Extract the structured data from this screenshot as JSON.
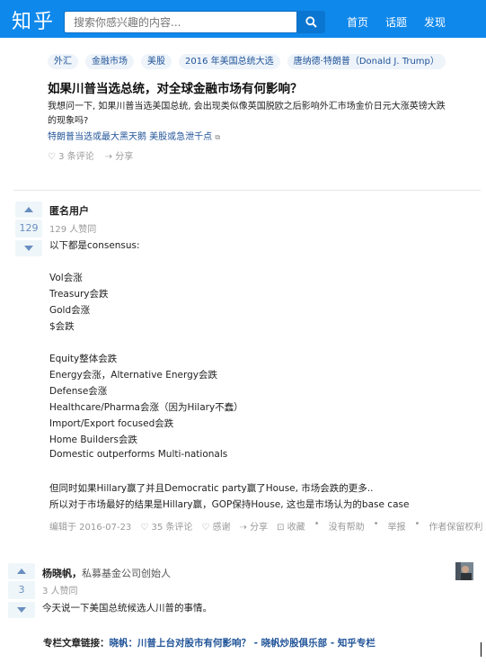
{
  "header": {
    "logo": "知乎",
    "search_placeholder": "搜索你感兴趣的内容...",
    "nav": [
      "首页",
      "话题",
      "发现"
    ],
    "color": "#0f88eb"
  },
  "question": {
    "topics": [
      "外汇",
      "金融市场",
      "美股",
      "2016 年美国总统大选",
      "唐纳德·特朗普（Donald J. Trump）"
    ],
    "title": "如果川普当选总统，对全球金融市场有何影响？",
    "desc_line1": "我想问一下, 如果川普当选美国总统, 会出现类似像英国脱欧之后影响外汇市场金价日元大涨英镑大跌",
    "desc_line2": "的现象吗?",
    "link": "特朗普当选或最大黑天鹅 美股或急泄千点",
    "comments": "3 条评论",
    "share": "分享"
  },
  "answer1": {
    "vote_count": "129",
    "author": "匿名用户",
    "votes_text": "129 人赞同",
    "lines": [
      "以下都是consensus:",
      "",
      "Vol会涨",
      "Treasury会跌",
      "Gold会涨",
      "$会跌",
      "",
      "Equity整体会跌",
      "Energy会涨，Alternative Energy会跌",
      "Defense会涨",
      "Healthcare/Pharma会涨（因为Hilary不蠢）",
      "Import/Export focused会跌",
      "Home Builders会跌",
      "Domestic outperforms Multi-nationals",
      "",
      "但同时如果Hillary赢了并且Democratic party赢了House, 市场会跌的更多..",
      "所以对于市场最好的结果是Hillary赢，GOP保持House, 这也是市场认为的base case"
    ],
    "meta": {
      "edited": "编辑于 2016-07-23",
      "comments": "35 条评论",
      "thanks": "感谢",
      "share": "分享",
      "collect": "收藏",
      "no_help": "没有帮助",
      "report": "举报",
      "copyright": "作者保留权利"
    }
  },
  "answer2": {
    "vote_count": "3",
    "author": "杨晓帆",
    "bio": "私募基金公司创始人",
    "votes_text": "3 人赞同",
    "first_line": "今天说一下美国总统候选人川普的事情。",
    "column_prefix": "专栏文章链接：",
    "column_link": "晓帆：川普上台对股市有何影响？ - 晓帆炒股俱乐部 - 知乎专栏"
  }
}
